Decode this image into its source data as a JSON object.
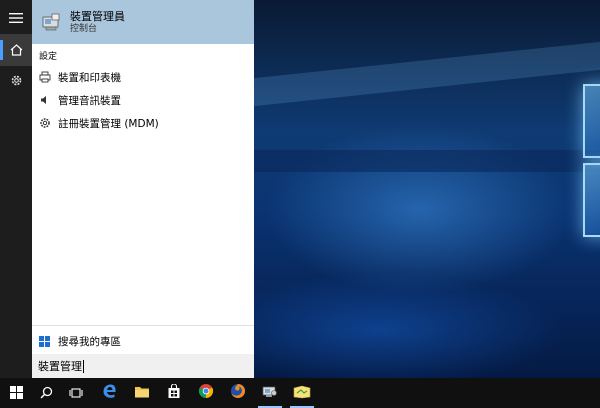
{
  "search_panel": {
    "best_match": {
      "title": "裝置管理員",
      "subtitle": "控制台",
      "icon": "device-manager-icon"
    },
    "section_header": "設定",
    "results": [
      {
        "label": "裝置和印表機",
        "icon": "printer-icon"
      },
      {
        "label": "管理音訊裝置",
        "icon": "speaker-icon"
      },
      {
        "label": "註冊裝置管理 (MDM)",
        "icon": "gear-icon"
      }
    ],
    "my_stuff": {
      "label": "搜尋我的專區",
      "icon": "windows-logo-icon"
    },
    "search_box": {
      "value": "裝置管理"
    }
  },
  "rail": {
    "items": [
      {
        "name": "hamburger-menu-icon"
      },
      {
        "name": "home-icon"
      },
      {
        "name": "gear-icon"
      }
    ]
  },
  "taskbar": {
    "items": [
      {
        "name": "start-button"
      },
      {
        "name": "search-button"
      },
      {
        "name": "task-view-button"
      },
      {
        "name": "edge-taskbar-button"
      },
      {
        "name": "file-explorer-taskbar-button"
      },
      {
        "name": "store-taskbar-button"
      },
      {
        "name": "chrome-taskbar-button"
      },
      {
        "name": "firefox-taskbar-button"
      },
      {
        "name": "device-manager-taskbar-button"
      },
      {
        "name": "app-taskbar-button"
      }
    ]
  },
  "colors": {
    "best_match_bg": "#a9c6dd",
    "rail_bg": "#1d1d1d",
    "taskbar_bg": "#101010",
    "accent": "#4a9eff"
  }
}
